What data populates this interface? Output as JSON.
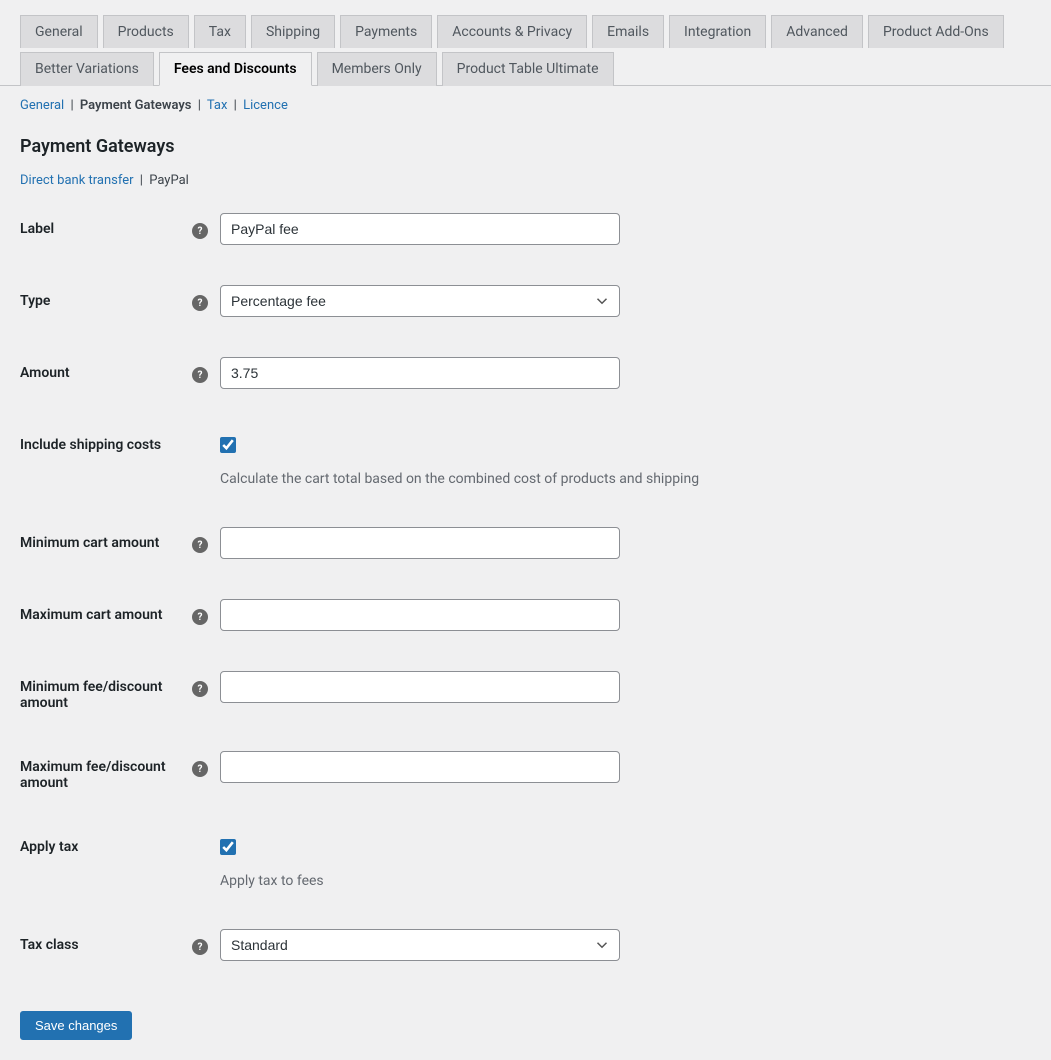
{
  "tabs": {
    "row1": [
      "General",
      "Products",
      "Tax",
      "Shipping",
      "Payments",
      "Accounts & Privacy",
      "Emails",
      "Integration",
      "Advanced",
      "Product Add-Ons"
    ],
    "row2": [
      "Better Variations",
      "Fees and Discounts",
      "Members Only",
      "Product Table Ultimate"
    ],
    "active": "Fees and Discounts"
  },
  "subnav": {
    "items": [
      "General",
      "Payment Gateways",
      "Tax",
      "Licence"
    ],
    "active": "Payment Gateways"
  },
  "heading": "Payment Gateways",
  "gateways": {
    "items": [
      "Direct bank transfer",
      "PayPal"
    ],
    "active": "PayPal"
  },
  "fields": {
    "label": {
      "title": "Label",
      "value": "PayPal fee"
    },
    "type": {
      "title": "Type",
      "value": "Percentage fee"
    },
    "amount": {
      "title": "Amount",
      "value": "3.75"
    },
    "include_shipping": {
      "title": "Include shipping costs",
      "desc": "Calculate the cart total based on the combined cost of products and shipping"
    },
    "min_cart": {
      "title": "Minimum cart amount",
      "value": ""
    },
    "max_cart": {
      "title": "Maximum cart amount",
      "value": ""
    },
    "min_fee": {
      "title": "Minimum fee/discount amount",
      "value": ""
    },
    "max_fee": {
      "title": "Maximum fee/discount amount",
      "value": ""
    },
    "apply_tax": {
      "title": "Apply tax",
      "desc": "Apply tax to fees"
    },
    "tax_class": {
      "title": "Tax class",
      "value": "Standard"
    }
  },
  "save_button": "Save changes"
}
